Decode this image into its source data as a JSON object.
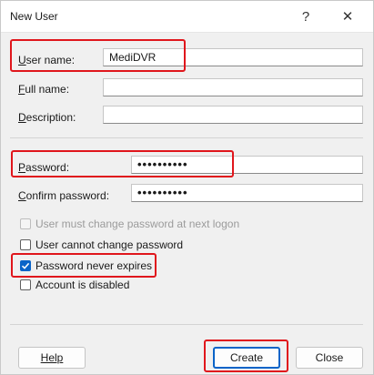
{
  "window": {
    "title": "New User",
    "help_glyph": "?",
    "close_glyph": "✕"
  },
  "fields": {
    "user_name": {
      "label_first": "U",
      "label_rest": "ser name:",
      "value": "MediDVR"
    },
    "full_name": {
      "label_first": "F",
      "label_rest": "ull name:",
      "value": ""
    },
    "description": {
      "label_first": "D",
      "label_rest": "escription:",
      "value": ""
    },
    "password": {
      "label_first": "P",
      "label_rest": "assword:",
      "value": "••••••••••"
    },
    "confirm_password": {
      "label_first": "C",
      "label_rest": "onfirm password:",
      "value": "••••••••••"
    }
  },
  "options": {
    "must_change": {
      "label": "User must change password at next logon",
      "checked": false,
      "disabled": true
    },
    "cannot_change": {
      "label": "User cannot change password",
      "checked": false,
      "disabled": false
    },
    "never_expires": {
      "label": "Password never expires",
      "checked": true,
      "disabled": false
    },
    "disabled_account": {
      "label": "Account is disabled",
      "checked": false,
      "disabled": false
    }
  },
  "buttons": {
    "help": "Help",
    "create": "Create",
    "close": "Close"
  },
  "colors": {
    "highlight": "#e0161c",
    "accent": "#0a64c8"
  }
}
